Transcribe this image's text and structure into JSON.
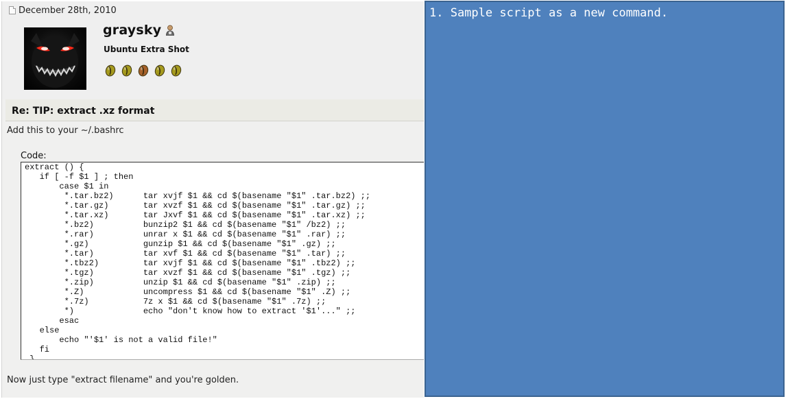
{
  "post": {
    "date": "December 28th, 2010",
    "username": "graysky",
    "user_title": "Ubuntu Extra Shot",
    "bean_colors": [
      "#a59a1e",
      "#a59a1e",
      "#a6612a",
      "#a59a1e",
      "#a59a1e"
    ],
    "title": "Re: TIP: extract .xz format",
    "intro": "Add this to your ~/.bashrc",
    "code_label": "Code:",
    "code": "extract () {\n   if [ -f $1 ] ; then\n       case $1 in\n        *.tar.bz2)      tar xvjf $1 && cd $(basename \"$1\" .tar.bz2) ;;\n        *.tar.gz)       tar xvzf $1 && cd $(basename \"$1\" .tar.gz) ;;\n        *.tar.xz)       tar Jxvf $1 && cd $(basename \"$1\" .tar.xz) ;;\n        *.bz2)          bunzip2 $1 && cd $(basename \"$1\" /bz2) ;;\n        *.rar)          unrar x $1 && cd $(basename \"$1\" .rar) ;;\n        *.gz)           gunzip $1 && cd $(basename \"$1\" .gz) ;;\n        *.tar)          tar xvf $1 && cd $(basename \"$1\" .tar) ;;\n        *.tbz2)         tar xvjf $1 && cd $(basename \"$1\" .tbz2) ;;\n        *.tgz)          tar xvzf $1 && cd $(basename \"$1\" .tgz) ;;\n        *.zip)          unzip $1 && cd $(basename \"$1\" .zip) ;;\n        *.Z)            uncompress $1 && cd $(basename \"$1\" .Z) ;;\n        *.7z)           7z x $1 && cd $(basename \"$1\" .7z) ;;\n        *)              echo \"don't know how to extract '$1'...\" ;;\n       esac\n   else\n       echo \"'$1' is not a valid file!\"\n   fi\n }",
    "outro": "Now just type \"extract filename\" and you're golden."
  },
  "note": {
    "text": "1. Sample script as a new command.",
    "background": "#4f81bd"
  },
  "icons": {
    "date_icon": "document-icon",
    "user_icon": "user-status-icon",
    "rank_icons": "coffee-bean-icon"
  }
}
